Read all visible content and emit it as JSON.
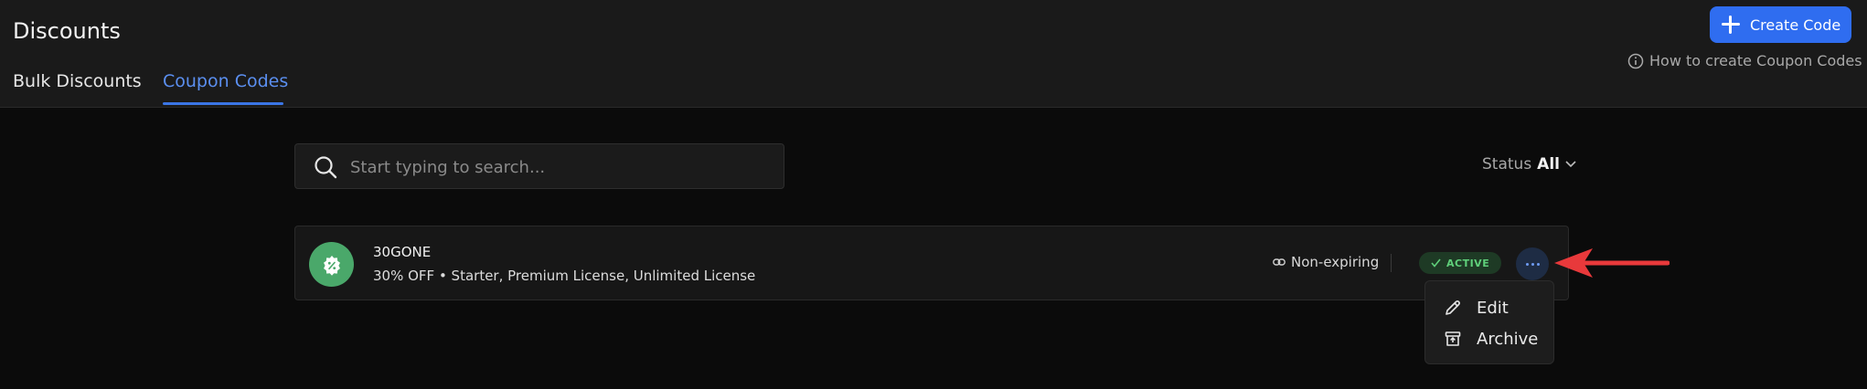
{
  "header": {
    "title": "Discounts",
    "tabs": [
      {
        "label": "Bulk Discounts",
        "active": false
      },
      {
        "label": "Coupon Codes",
        "active": true
      }
    ],
    "create_button": "Create Code",
    "help_link": "How to create Coupon Codes"
  },
  "search": {
    "placeholder": "Start typing to search...",
    "value": ""
  },
  "filter": {
    "label": "Status",
    "value": "All"
  },
  "coupons": [
    {
      "code": "30GONE",
      "description": "30% OFF • Starter, Premium License, Unlimited License",
      "expiry": "Non-expiring",
      "status": "ACTIVE"
    }
  ],
  "menu": {
    "items": [
      {
        "label": "Edit",
        "icon": "pencil-icon"
      },
      {
        "label": "Archive",
        "icon": "archive-icon"
      }
    ]
  },
  "colors": {
    "accent": "#2f6df0",
    "active_tab": "#5b8ff0",
    "coupon_icon_bg": "#4aa86a",
    "status_active": "#5fcf7a",
    "annotation_arrow": "#e8393b"
  }
}
